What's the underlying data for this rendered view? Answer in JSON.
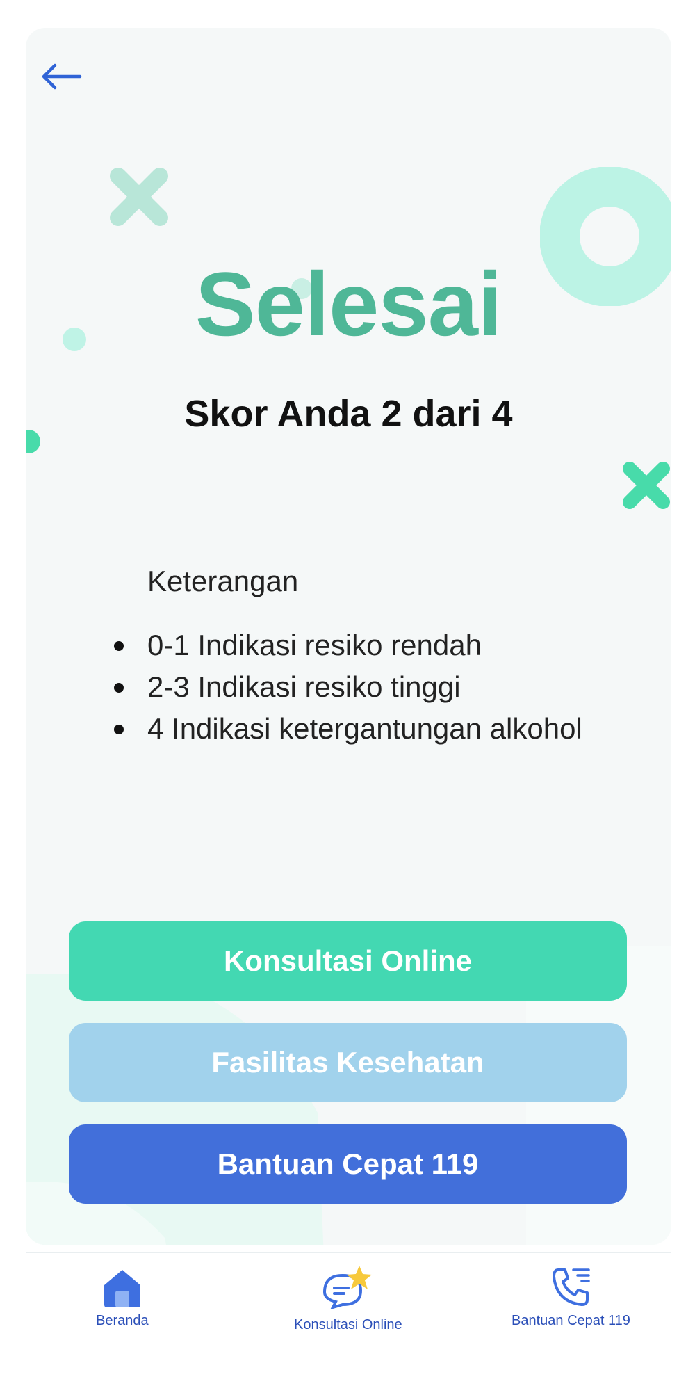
{
  "page": {
    "title": "Selesai",
    "score_text": "Skor Anda 2 dari 4"
  },
  "legend": {
    "label": "Keterangan",
    "items": [
      "0-1 Indikasi resiko rendah",
      "2-3 Indikasi resiko tinggi",
      "4 Indikasi ketergantungan alkohol"
    ]
  },
  "buttons": {
    "konsultasi": "Konsultasi Online",
    "fasilitas": "Fasilitas Kesehatan",
    "bantuan": "Bantuan Cepat 119"
  },
  "bottom_nav": {
    "items": [
      {
        "label": "Beranda",
        "icon": "home-icon"
      },
      {
        "label": "Konsultasi Online",
        "icon": "chat-icon"
      },
      {
        "label": "Bantuan Cepat 119",
        "icon": "phone-icon"
      }
    ]
  },
  "colors": {
    "title": "#4fb797",
    "konsultasi": "#43d8b2",
    "fasilitas": "#a1d2ec",
    "bantuan": "#426fda",
    "nav": "#2b4fb8"
  }
}
